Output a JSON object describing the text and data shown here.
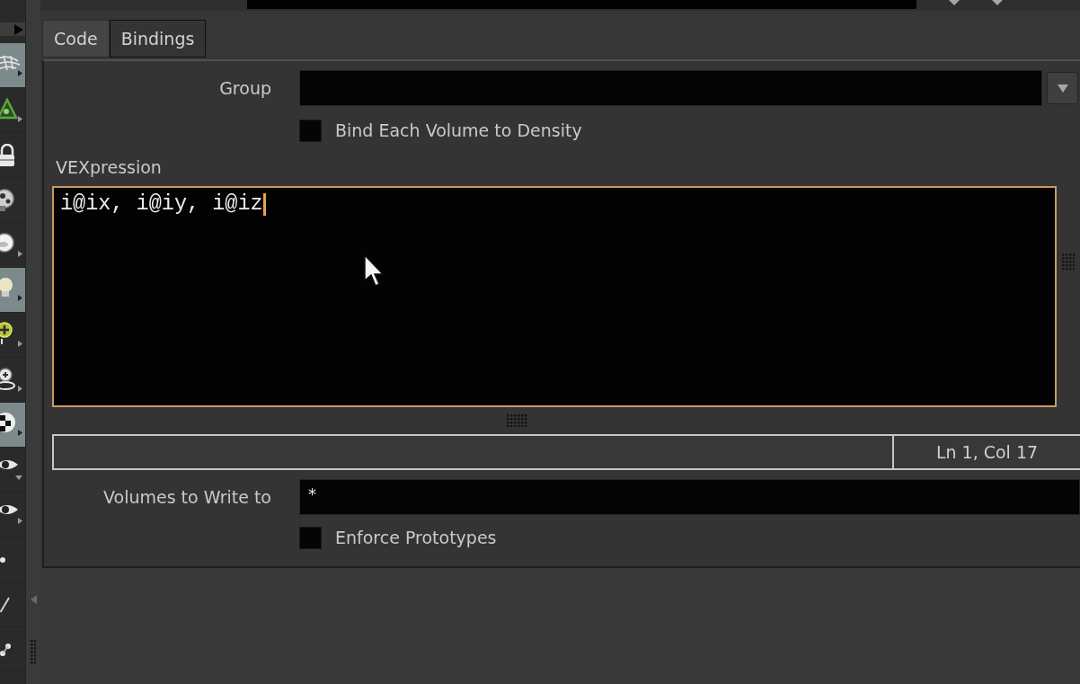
{
  "toolbar": {
    "tools": [
      {
        "selected": true
      },
      {
        "selected": false
      },
      {
        "selected": false
      },
      {
        "selected": false
      },
      {
        "selected": false
      },
      {
        "selected": true
      },
      {
        "selected": false
      },
      {
        "selected": false
      },
      {
        "selected": true
      },
      {
        "selected": false
      },
      {
        "selected": false
      },
      {
        "selected": false
      },
      {
        "selected": false
      },
      {
        "selected": false
      }
    ]
  },
  "tabs": [
    {
      "label": "Code",
      "selected": true
    },
    {
      "label": "Bindings",
      "selected": false
    }
  ],
  "group": {
    "label": "Group"
  },
  "bind_each_volume": {
    "label": "Bind Each Volume to Density",
    "checked": false
  },
  "vexpression": {
    "label": "VEXpression",
    "code": "i@ix, i@iy, i@iz",
    "focused": true
  },
  "status_bar": {
    "cursor_position": "Ln 1, Col 17"
  },
  "volumes_to_write": {
    "label": "Volumes to Write to",
    "value": "*"
  },
  "enforce_prototypes": {
    "label": "Enforce Prototypes",
    "checked": false
  }
}
